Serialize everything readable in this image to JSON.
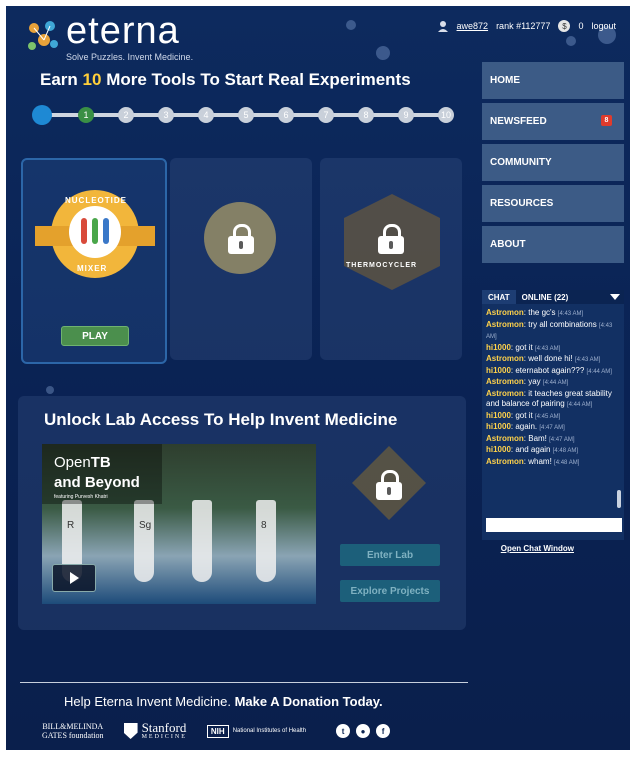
{
  "header": {
    "logo_word": "eterna",
    "tagline": "Solve Puzzles. Invent Medicine.",
    "username": "awe872",
    "rank": "rank #112777",
    "coins": "0",
    "logout": "logout"
  },
  "tools": {
    "title_prefix": "Earn",
    "title_count": "10",
    "title_suffix": "More Tools To Start Real Experiments",
    "steps": [
      "1",
      "2",
      "3",
      "4",
      "5",
      "6",
      "7",
      "8",
      "9",
      "10"
    ],
    "steps_completed": 1,
    "card1_top": "NUCLEOTIDE",
    "card1_bottom": "MIXER",
    "card3_label": "THERMOCYCLER",
    "play_label": "PLAY"
  },
  "nav": {
    "items": [
      {
        "label": "HOME"
      },
      {
        "label": "NEWSFEED",
        "badge": "8"
      },
      {
        "label": "COMMUNITY"
      },
      {
        "label": "RESOURCES"
      },
      {
        "label": "ABOUT"
      }
    ]
  },
  "chat": {
    "tab_chat": "CHAT",
    "tab_online": "ONLINE (22)",
    "messages": [
      {
        "user": "Astromon",
        "text": ": the gc's",
        "time": "[4:43 AM]"
      },
      {
        "user": "Astromon",
        "text": ": try all combinations",
        "time": "[4:43 AM]"
      },
      {
        "user": "hi1000",
        "text": ": got it",
        "time": "[4:43 AM]"
      },
      {
        "user": "Astromon",
        "text": ": well done hi!",
        "time": "[4:43 AM]"
      },
      {
        "user": "hi1000",
        "text": ": eternabot again???",
        "time": "[4:44 AM]"
      },
      {
        "user": "Astromon",
        "text": ": yay",
        "time": "[4:44 AM]"
      },
      {
        "user": "Astromon",
        "text": ": it teaches great stability and balance of pairing",
        "time": "[4:44 AM]"
      },
      {
        "user": "hi1000",
        "text": ": got it",
        "time": "[4:45 AM]"
      },
      {
        "user": "hi1000",
        "text": ": again.",
        "time": "[4:47 AM]"
      },
      {
        "user": "Astromon",
        "text": ": Bam!",
        "time": "[4:47 AM]"
      },
      {
        "user": "hi1000",
        "text": ": and again",
        "time": "[4:48 AM]"
      },
      {
        "user": "Astromon",
        "text": ": wham!",
        "time": "[4:48 AM]"
      }
    ],
    "open_window": "Open Chat Window"
  },
  "lab": {
    "title": "Unlock Lab Access To Help Invent Medicine",
    "video_line1_pre": "Open",
    "video_line1_bold": "TB",
    "video_line2": "and Beyond",
    "video_line3": "featuring Purvesh Khatri",
    "tube_labels": [
      "R",
      "Sg",
      "",
      "8"
    ],
    "enter_lab": "Enter Lab",
    "explore_projects": "Explore Projects"
  },
  "footer": {
    "donate_pre": "Help Eterna Invent Medicine.",
    "donate_bold": "Make A Donation Today.",
    "gates_line1": "BILL&MELINDA",
    "gates_line2": "GATES foundation",
    "stanford_line1": "Stanford",
    "stanford_line2": "MEDICINE",
    "nih_mark": "NIH",
    "nih_text": "National Institutes of Health",
    "social": [
      "t",
      "●",
      "f"
    ]
  },
  "colors": {
    "background": "#0a2253",
    "accent_yellow": "#ffcf3a",
    "play_green": "#4b8f4d",
    "nav_bg": "#3c5b86",
    "badge_red": "#e03b2c"
  }
}
